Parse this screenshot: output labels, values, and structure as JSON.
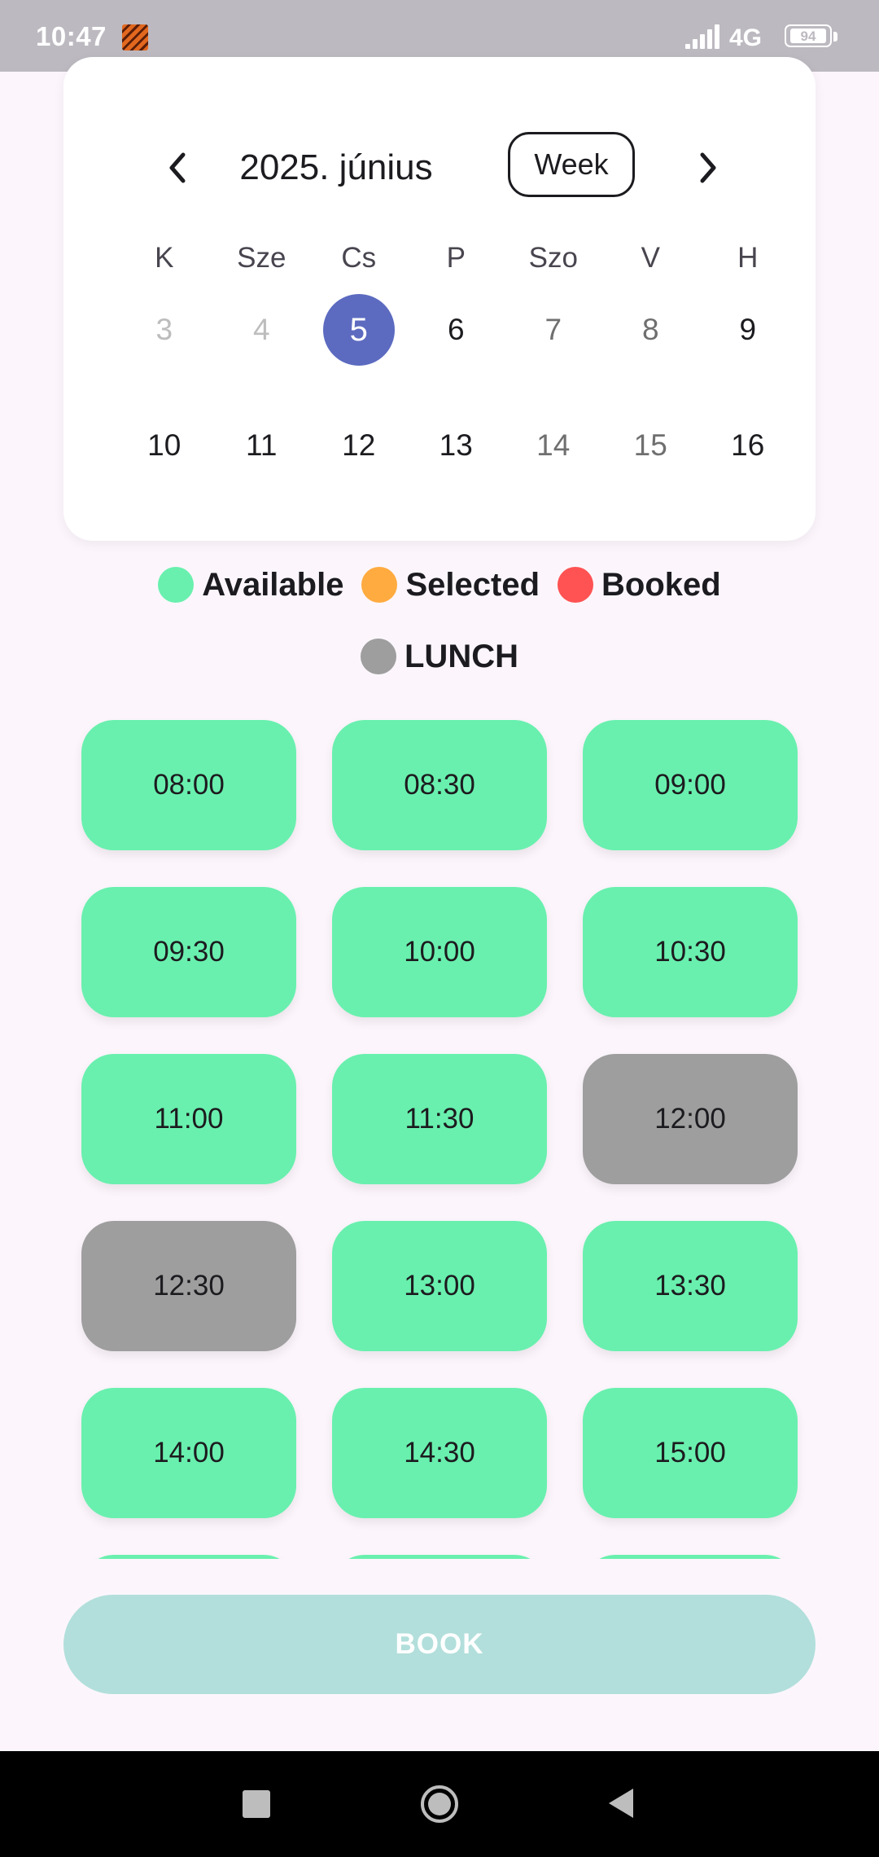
{
  "status_bar": {
    "time": "10:47",
    "network": "4G",
    "battery": "94",
    "icons": [
      "notification-app-icon",
      "signal-icon",
      "battery-icon"
    ]
  },
  "calendar": {
    "title": "2025. június",
    "format_button": "Week",
    "prev_icon": "chevron-left-icon",
    "next_icon": "chevron-right-icon",
    "weekdays": [
      "K",
      "Sze",
      "Cs",
      "P",
      "Szo",
      "V",
      "H"
    ],
    "weeks": [
      [
        {
          "day": "3",
          "state": "past"
        },
        {
          "day": "4",
          "state": "past"
        },
        {
          "day": "5",
          "state": "today"
        },
        {
          "day": "6",
          "state": "normal"
        },
        {
          "day": "7",
          "state": "weekend"
        },
        {
          "day": "8",
          "state": "weekend"
        },
        {
          "day": "9",
          "state": "normal"
        }
      ],
      [
        {
          "day": "10",
          "state": "normal"
        },
        {
          "day": "11",
          "state": "normal"
        },
        {
          "day": "12",
          "state": "normal"
        },
        {
          "day": "13",
          "state": "normal"
        },
        {
          "day": "14",
          "state": "weekend"
        },
        {
          "day": "15",
          "state": "weekend"
        },
        {
          "day": "16",
          "state": "normal"
        }
      ]
    ],
    "today_color": "#5C6BC0"
  },
  "legend": [
    {
      "label": "Available",
      "color": "#69F0AE"
    },
    {
      "label": "Selected",
      "color": "#FFAB40"
    },
    {
      "label": "Booked",
      "color": "#FF5252"
    },
    {
      "label": "LUNCH",
      "color": "#9E9E9E"
    }
  ],
  "slots": [
    {
      "time": "08:00",
      "status": "available"
    },
    {
      "time": "08:30",
      "status": "available"
    },
    {
      "time": "09:00",
      "status": "available"
    },
    {
      "time": "09:30",
      "status": "available"
    },
    {
      "time": "10:00",
      "status": "available"
    },
    {
      "time": "10:30",
      "status": "available"
    },
    {
      "time": "11:00",
      "status": "available"
    },
    {
      "time": "11:30",
      "status": "available"
    },
    {
      "time": "12:00",
      "status": "lunch"
    },
    {
      "time": "12:30",
      "status": "lunch"
    },
    {
      "time": "13:00",
      "status": "available"
    },
    {
      "time": "13:30",
      "status": "available"
    },
    {
      "time": "14:00",
      "status": "available"
    },
    {
      "time": "14:30",
      "status": "available"
    },
    {
      "time": "15:00",
      "status": "available"
    },
    {
      "time": "",
      "status": "available"
    },
    {
      "time": "",
      "status": "available"
    },
    {
      "time": "",
      "status": "available"
    }
  ],
  "slot_colors": {
    "available": "#69F0AE",
    "selected": "#FFAB40",
    "booked": "#FF5252",
    "lunch": "#9E9E9E"
  },
  "book_button": {
    "label": "BOOK",
    "color": "#B2DFDB"
  },
  "nav_bar": {
    "icons": [
      "recents-icon",
      "home-icon",
      "back-icon"
    ]
  }
}
